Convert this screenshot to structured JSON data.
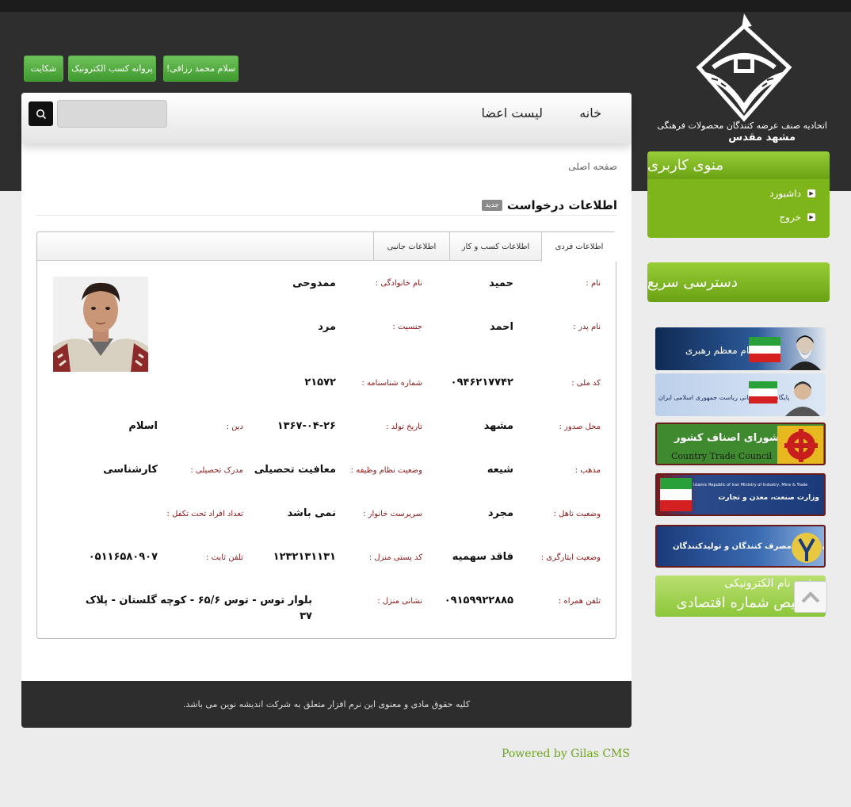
{
  "header": {
    "buttons": [
      "سلام محمد رزاقی!",
      "پروانه کسب الکترونیک",
      "شکایت"
    ],
    "org_line1": "اتحادیه صنف عرضه کنندگان محصولات فرهنگی",
    "org_line2": "مشهد مقدس"
  },
  "nav": {
    "home": "خانه",
    "members": "لیست اعضا",
    "search_placeholder": ""
  },
  "breadcrumb": "صفحه اصلی",
  "section": {
    "title": "اطلاعات درخواست",
    "badge": "جدید"
  },
  "tabs": [
    "اطلاعات فردی",
    "اطلاعات کسب و کار",
    "اطلاعات جانبی"
  ],
  "fields": {
    "first_name": {
      "label": "نام :",
      "value": "حمید"
    },
    "last_name": {
      "label": "نام خانوادگی :",
      "value": "ممدوحی"
    },
    "father_name": {
      "label": "نام پدر :",
      "value": "احمد"
    },
    "gender": {
      "label": "جنسیت :",
      "value": "مرد"
    },
    "national_code": {
      "label": "کد ملی :",
      "value": "۰۹۴۶۲۱۷۷۴۲"
    },
    "id_number": {
      "label": "شماره شناسنامه :",
      "value": "۲۱۵۷۲"
    },
    "issue_place": {
      "label": "محل صدور :",
      "value": "مشهد"
    },
    "birth_date": {
      "label": "تاریخ تولد :",
      "value": "۱۳۶۷-۰۴-۲۶"
    },
    "religion": {
      "label": "دین :",
      "value": "اسلام"
    },
    "sect": {
      "label": "مذهب :",
      "value": "شیعه"
    },
    "military": {
      "label": "وضعیت نظام وظیفه :",
      "value": "معافیت تحصیلی"
    },
    "education": {
      "label": "مدرک تحصیلی :",
      "value": "کارشناسی"
    },
    "marital": {
      "label": "وضعیت تاهل :",
      "value": "مجرد"
    },
    "head_of_family": {
      "label": "سرپرست خانوار :",
      "value": "نمی باشد"
    },
    "dependents": {
      "label": "تعداد افراد تحت تکفل :",
      "value": ""
    },
    "veteran": {
      "label": "وضعیت ایثارگری :",
      "value": "فاقد سهمیه"
    },
    "postal_code": {
      "label": "کد پستی منزل :",
      "value": "۱۲۳۲۱۳۱۱۳۱"
    },
    "landline": {
      "label": "تلفن ثابت :",
      "value": "۰۵۱۱۶۵۸۰۹۰۷"
    },
    "mobile": {
      "label": "تلفن همراه :",
      "value": "۰۹۱۵۹۹۲۲۸۸۵"
    },
    "address": {
      "label": "نشانی منزل :",
      "value_line1": "بلوار توس - توس ۶۵/۶ - کوچه گلستان - پلاک",
      "value_line2": "۳۷"
    }
  },
  "footer": {
    "copyright": "کلیه حقوق مادی و معنوی این نرم افزار متعلق به شرکت اندیشه نوین می باشد.",
    "powered": "Powered by Gilas CMS"
  },
  "sidebar": {
    "user_menu_title": "منوی کاربری",
    "user_menu_items": [
      "داشبورد",
      "خروج"
    ],
    "quick_access_title": "دسترسی سریع",
    "banners": [
      {
        "text": "دفتر مقام معظم رهبری"
      },
      {
        "text": "پایگاه اطلاع رسانی ریاست جمهوری اسلامی ایران"
      },
      {
        "text": "شورای اصناف کشور",
        "sub": "Country Trade Council"
      },
      {
        "text": "وزارت صنعت، معدن و تجارت",
        "sub": "Islamic Republic of Iran Ministry of Industry, Mine & Trade"
      },
      {
        "text": "سازمان حمایت مصرف کنندگان و تولیدکنندگان"
      },
      {
        "text": "ثبت نام الکترونیکی",
        "sub": "تخصیص شماره اقتصادی"
      }
    ]
  }
}
